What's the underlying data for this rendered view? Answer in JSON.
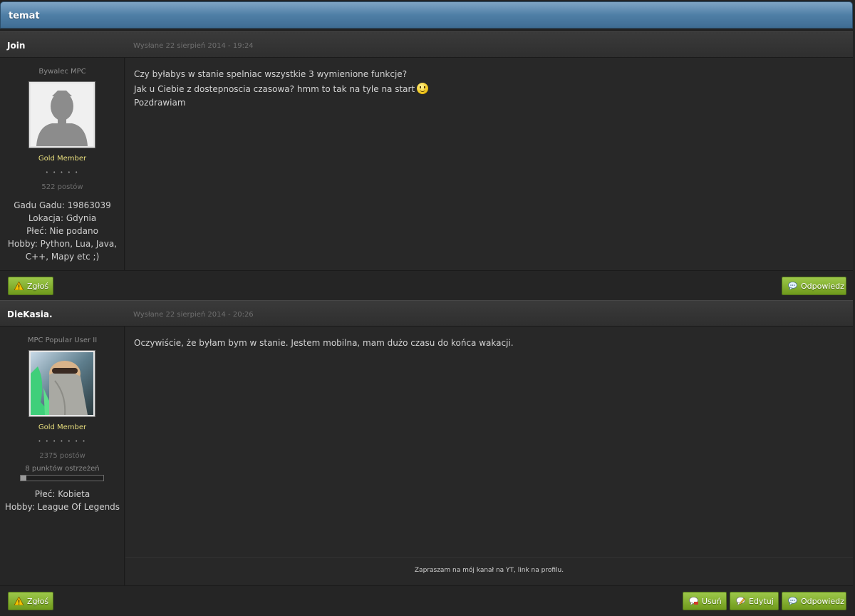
{
  "topic": {
    "title": "temat"
  },
  "posts": [
    {
      "author": "Join",
      "date": "Wysłane 22 sierpień 2014 - 19:24",
      "rank_title": "Bywalec MPC",
      "group": "Gold Member",
      "pips": "• • • • •",
      "post_count": "522 postów",
      "info": [
        "Gadu Gadu: 19863039",
        "Lokacja: Gdynia",
        "Płeć: Nie podano",
        "Hobby: Python, Lua, Java,",
        "C++, Mapy etc ;)"
      ],
      "body": [
        "Czy byłabys w stanie spelniac wszystkie 3 wymienione funkcje?",
        "Jak u Ciebie z dostepnoscia czasowa? hmm to tak na tyle na start",
        "Pozdrawiam"
      ],
      "buttons": {
        "report": "Zgłoś",
        "reply": "Odpowiedz"
      }
    },
    {
      "author": "DieKasia.",
      "date": "Wysłane 22 sierpień 2014 - 20:26",
      "rank_title": "MPC Popular User II",
      "group": "Gold Member",
      "pips": "• • • • • • •",
      "post_count": "2375 postów",
      "warn_label": "8 punktów ostrzeżeń",
      "warn_level_percent": 7,
      "info": [
        "Płeć: Kobieta",
        "Hobby: League Of Legends"
      ],
      "body": [
        "Oczywiście, że byłam bym w stanie. Jestem mobilna, mam dużo czasu do końca wakacji."
      ],
      "signature": "Zapraszam na mój kanał na YT, link na profilu.",
      "buttons": {
        "report": "Zgłoś",
        "delete": "Usuń",
        "edit": "Edytuj",
        "reply": "Odpowiedz"
      }
    }
  ],
  "colors": {
    "accent_green": "#7fae2a",
    "header_blue": "#5a87ad",
    "group_gold": "#e9df7e"
  }
}
